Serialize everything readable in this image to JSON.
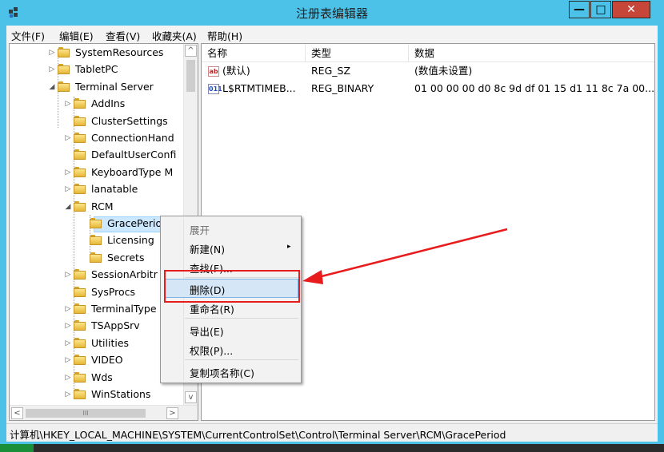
{
  "window": {
    "title": "注册表编辑器"
  },
  "controls": {
    "minimize": "—",
    "maximize": "□",
    "close": "✕"
  },
  "menu": [
    "文件(F)",
    "编辑(E)",
    "查看(V)",
    "收藏夹(A)",
    "帮助(H)"
  ],
  "tree": {
    "nodes": [
      {
        "label": "SystemResources",
        "expander": "▷"
      },
      {
        "label": "TabletPC",
        "expander": "▷"
      },
      {
        "label": "Terminal Server",
        "expander": "◢"
      },
      {
        "label": "AddIns",
        "expander": "▷"
      },
      {
        "label": "ClusterSettings",
        "expander": ""
      },
      {
        "label": "ConnectionHand",
        "expander": "▷"
      },
      {
        "label": "DefaultUserConfi",
        "expander": ""
      },
      {
        "label": "KeyboardType M",
        "expander": "▷"
      },
      {
        "label": "lanatable",
        "expander": "▷"
      },
      {
        "label": "RCM",
        "expander": "◢"
      },
      {
        "label": "GracePeriod",
        "expander": ""
      },
      {
        "label": "Licensing",
        "expander": ""
      },
      {
        "label": "Secrets",
        "expander": ""
      },
      {
        "label": "SessionArbitr",
        "expander": "▷"
      },
      {
        "label": "SysProcs",
        "expander": ""
      },
      {
        "label": "TerminalType",
        "expander": "▷"
      },
      {
        "label": "TSAppSrv",
        "expander": "▷"
      },
      {
        "label": "Utilities",
        "expander": "▷"
      },
      {
        "label": "VIDEO",
        "expander": "▷"
      },
      {
        "label": "Wds",
        "expander": "▷"
      },
      {
        "label": "WinStations",
        "expander": "▷"
      }
    ],
    "selected": "GracePeriod"
  },
  "scroll": {
    "up": "^",
    "down": "v",
    "left": "<",
    "right": ">",
    "grip": "III"
  },
  "values": {
    "columns": [
      "名称",
      "类型",
      "数据"
    ],
    "rows": [
      {
        "icon": "ab",
        "name": "(默认)",
        "type": "REG_SZ",
        "data": "(数值未设置)"
      },
      {
        "icon": "011",
        "name": "L$RTMTIMEB...",
        "type": "REG_BINARY",
        "data": "01 00 00 00 d0 8c 9d df 01 15 d1 11 8c 7a 00..."
      }
    ]
  },
  "context_menu": {
    "items": [
      "展开",
      "新建(N)",
      "查找(F)...",
      "删除(D)",
      "重命名(R)",
      "导出(E)",
      "权限(P)...",
      "复制项名称(C)"
    ],
    "submenu_arrow": "▸",
    "highlighted": "删除(D)"
  },
  "status": "计算机\\HKEY_LOCAL_MACHINE\\SYSTEM\\CurrentControlSet\\Control\\Terminal Server\\RCM\\GracePeriod",
  "colors": {
    "titlebar": "#4cc2e8",
    "close": "#c7463a",
    "annotation": "#e81c1c",
    "selection": "#cce8ff"
  }
}
